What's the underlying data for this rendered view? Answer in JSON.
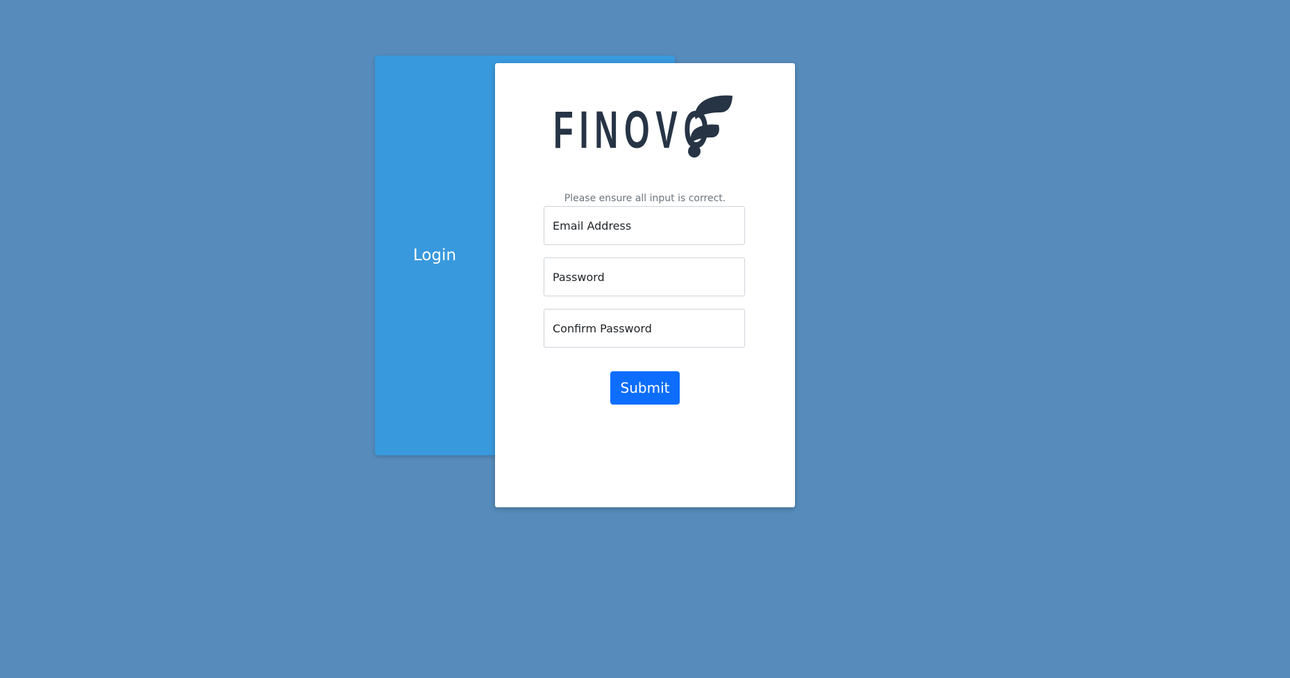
{
  "auth": {
    "login_tab_label": "Login",
    "brand_name": "FINOVO",
    "logo_icon": "finovo-f-mark-icon",
    "hint": "Please ensure all input is correct.",
    "fields": {
      "email_placeholder": "Email Address",
      "email_value": "",
      "password_placeholder": "Password",
      "password_value": "",
      "confirm_placeholder": "Confirm Password",
      "confirm_value": ""
    },
    "submit_label": "Submit"
  },
  "colors": {
    "page_background": "#568bbb",
    "back_card": "#3899dd",
    "front_card": "#ffffff",
    "brand_text": "#263445",
    "hint_text": "#6c757d",
    "submit_button": "#0d6efd"
  }
}
